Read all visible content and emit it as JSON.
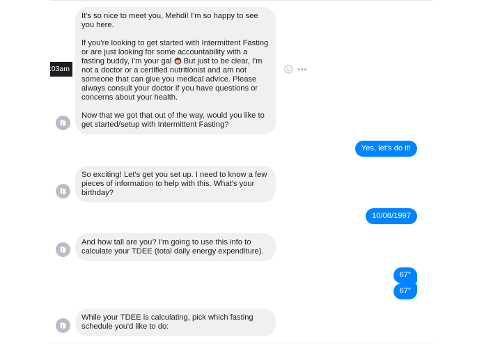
{
  "chat": {
    "timestamp": ":03am",
    "messages": [
      {
        "from": "bot",
        "paragraphs": [
          "It's so nice to meet you, Mehdi! I'm so happy to see you here.",
          {
            "before": "If you're looking to get started with Intermittent Fasting or are just looking for some accountability with a fasting buddy, I'm your gal ",
            "emoji": "woman-emoji",
            "after": " But just to be clear, I'm not a doctor or a certified nutritionist and am not someone that can give you medical advice. Please always consult your doctor if you have questions or concerns about your health."
          },
          "Now that we got that out of the way, would you like to get started/setup with Intermittent Fasting?"
        ]
      },
      {
        "from": "user",
        "text": "Yes, let's do it!"
      },
      {
        "from": "bot",
        "text": "So exciting! Let's get you set up. I need to know a few pieces of information to help with this. What's your birthday?"
      },
      {
        "from": "user",
        "text": "10/06/1997"
      },
      {
        "from": "bot",
        "text": "And how tall are you? I'm going to use this info to calculate your TDEE (total daily energy expenditure)."
      },
      {
        "from": "user",
        "text": "67\""
      },
      {
        "from": "user",
        "text": "67\""
      },
      {
        "from": "bot",
        "text": "While your TDEE is calculating, pick which fasting schedule you'd like to do:"
      }
    ],
    "actions": {
      "react_icon": "smiley-icon",
      "more_icon": "more-dots-icon",
      "more_glyph": "•••"
    },
    "colors": {
      "outgoing": "#0084ff",
      "incoming": "#f1f0f0",
      "avatar": "#b9bec5"
    }
  }
}
